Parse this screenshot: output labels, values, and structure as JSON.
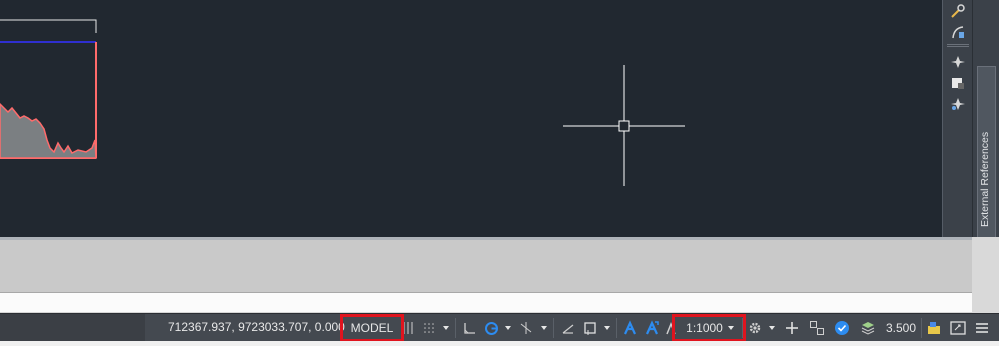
{
  "sidebar": {
    "panel_title": "External References"
  },
  "status_bar": {
    "coordinates": "712367.937, 9723033.707, 0.000",
    "model_label": "MODEL",
    "annotation_scale": "1:1000",
    "lineweight_value": "3.500"
  },
  "icons": {
    "grid": "grid-icon",
    "snap": "snap-icon",
    "ortho": "ortho-icon",
    "polar": "polar-tracking-icon",
    "isodraft": "isodraft-icon",
    "osnap_track": "object-snap-tracking-icon",
    "osnap": "object-snap-icon",
    "annotation_visibility": "annotation-visibility-icon",
    "auto_scale": "auto-scale-icon",
    "annotation_scale": "annotation-scale-icon",
    "workspace": "gear-icon",
    "add": "plus-icon",
    "units": "units-icon",
    "quick_properties": "quick-properties-icon",
    "isolate": "isolate-objects-icon",
    "hardware": "hardware-acceleration-icon",
    "clean_screen": "clean-screen-icon",
    "menu": "hamburger-menu-icon"
  },
  "colors": {
    "canvas_bg": "#212830",
    "highlight": "#e0141e",
    "active_blue": "#2d8cf0",
    "profile_red": "#ff6b6b"
  }
}
